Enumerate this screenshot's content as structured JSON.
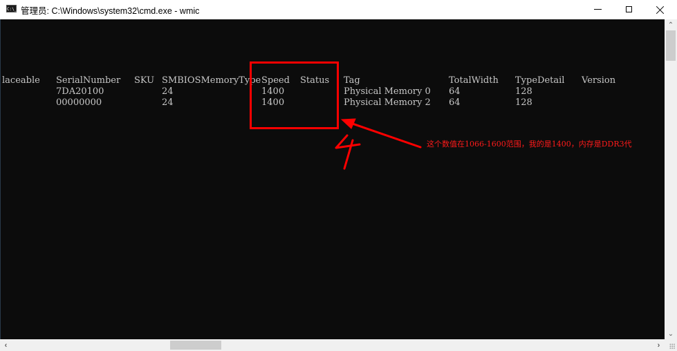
{
  "window": {
    "title": "管理员: C:\\Windows\\system32\\cmd.exe - wmic",
    "app_icon_text": "C:\\_",
    "controls": [
      "minimize",
      "maximize",
      "close"
    ]
  },
  "console": {
    "text_color": "#c8c8c8",
    "background": "#0c0c0c",
    "columns": [
      {
        "header": "laceable",
        "rows": [
          "",
          ""
        ]
      },
      {
        "header": "SerialNumber",
        "rows": [
          "7DA20100",
          "00000000"
        ]
      },
      {
        "header": "SKU",
        "rows": [
          "",
          ""
        ]
      },
      {
        "header": "SMBIOSMemoryType",
        "rows": [
          "24",
          "24"
        ]
      },
      {
        "header": "Speed",
        "rows": [
          "1400",
          "1400"
        ]
      },
      {
        "header": "Status",
        "rows": [
          "",
          ""
        ]
      },
      {
        "header": "Tag",
        "rows": [
          "Physical Memory 0",
          "Physical Memory 2"
        ]
      },
      {
        "header": "TotalWidth",
        "rows": [
          "64",
          "64"
        ]
      },
      {
        "header": "TypeDetail",
        "rows": [
          "128",
          "128"
        ]
      },
      {
        "header": "Version",
        "rows": [
          "",
          ""
        ]
      }
    ]
  },
  "annotation": {
    "color": "#ff0000",
    "step_number": "4",
    "note": "这个数值在1066-1600范围，我的是1400，内存是DDR3代"
  },
  "scrollbars": {
    "vertical_arrows": {
      "up": "chevron-up",
      "down": "chevron-down"
    },
    "horizontal_arrows": {
      "left": "chevron-left",
      "right": "chevron-right"
    }
  }
}
